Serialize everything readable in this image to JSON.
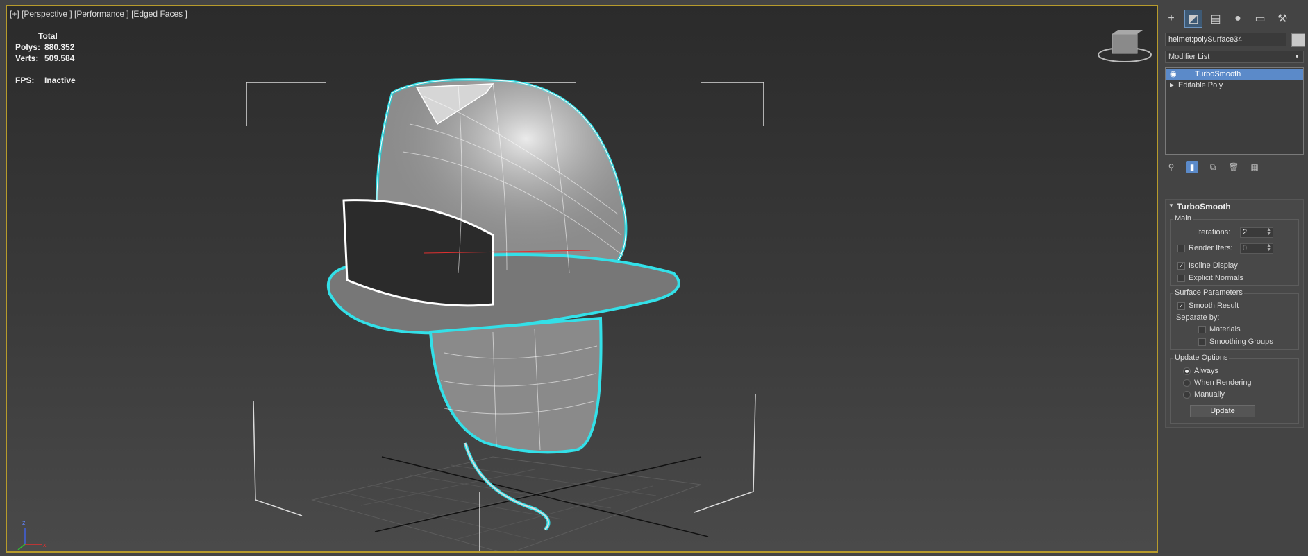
{
  "viewport": {
    "label": "[+] [Perspective ] [Performance ] [Edged Faces ]",
    "stats": {
      "total_label": "Total",
      "polys_label": "Polys:",
      "polys_value": "880.352",
      "verts_label": "Verts:",
      "verts_value": "509.584",
      "fps_label": "FPS:",
      "fps_value": "Inactive"
    },
    "axis": {
      "x": "x",
      "y": "y",
      "z": "z"
    },
    "colors": {
      "selection_outline": "#33e0e8",
      "frame": "#b79b2c"
    }
  },
  "panel": {
    "toolbar": [
      "create-icon",
      "modify-icon",
      "hierarchy-icon",
      "motion-icon",
      "display-icon",
      "utilities-icon"
    ],
    "object_name": "helmet:polySurface34",
    "modifier_list": "Modifier List",
    "stack": [
      {
        "label": "TurboSmooth",
        "selected": true
      },
      {
        "label": "Editable Poly",
        "selected": false
      }
    ],
    "turbosmooth": {
      "title": "TurboSmooth",
      "main_group": "Main",
      "iterations_label": "Iterations:",
      "iterations_value": "2",
      "render_iters_label": "Render Iters:",
      "render_iters_value": "0",
      "isoline_label": "Isoline Display",
      "explicit_normals_label": "Explicit Normals",
      "surface_group": "Surface Parameters",
      "smooth_result_label": "Smooth Result",
      "separate_by_label": "Separate by:",
      "materials_label": "Materials",
      "smoothing_groups_label": "Smoothing Groups",
      "update_group": "Update Options",
      "always_label": "Always",
      "when_rendering_label": "When Rendering",
      "manually_label": "Manually",
      "update_button": "Update"
    },
    "colors": {
      "selected": "#5b8ac9",
      "panel_bg": "#444444"
    }
  }
}
